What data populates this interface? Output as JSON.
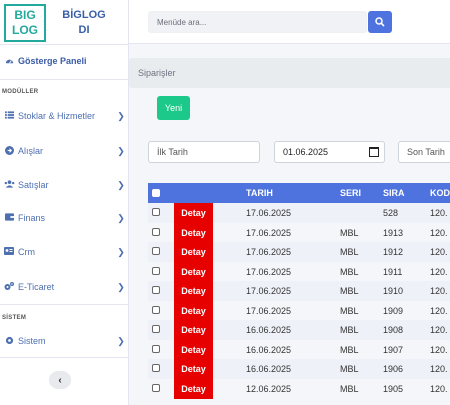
{
  "logo": {
    "line1": "BIG",
    "line2": "LOG"
  },
  "brand": {
    "line1": "BİGLOG",
    "line2": "DI"
  },
  "search": {
    "placeholder": "Menüde ara..."
  },
  "sidebar": {
    "dashboard": "Gösterge Paneli",
    "section_modules": "MODÜLLER",
    "section_system": "SİSTEM",
    "items": [
      {
        "label": "Stoklar & Hizmetler",
        "icon": "list-icon"
      },
      {
        "label": "Alışlar",
        "icon": "arrow-circle-icon"
      },
      {
        "label": "Satışlar",
        "icon": "users-icon"
      },
      {
        "label": "Finans",
        "icon": "wallet-icon"
      },
      {
        "label": "Crm",
        "icon": "id-card-icon"
      },
      {
        "label": "E-Ticaret",
        "icon": "gears-icon"
      },
      {
        "label": "Sistem",
        "icon": "gear-icon"
      }
    ]
  },
  "breadcrumb": "Siparişler",
  "new_button": "Yeni",
  "filters": {
    "start_placeholder": "İlk Tarih",
    "date_value": "01.06.2025",
    "end_placeholder": "Son Tarih"
  },
  "table": {
    "headers": [
      "TARIH",
      "SERI",
      "SIRA",
      "KOD"
    ],
    "detail_label": "Detay",
    "rows": [
      {
        "date": "17.06.2025",
        "seri": "",
        "sira": "528",
        "kod": "120."
      },
      {
        "date": "17.06.2025",
        "seri": "MBL",
        "sira": "1913",
        "kod": "120."
      },
      {
        "date": "17.06.2025",
        "seri": "MBL",
        "sira": "1912",
        "kod": "120."
      },
      {
        "date": "17.06.2025",
        "seri": "MBL",
        "sira": "1911",
        "kod": "120."
      },
      {
        "date": "17.06.2025",
        "seri": "MBL",
        "sira": "1910",
        "kod": "120."
      },
      {
        "date": "17.06.2025",
        "seri": "MBL",
        "sira": "1909",
        "kod": "120."
      },
      {
        "date": "16.06.2025",
        "seri": "MBL",
        "sira": "1908",
        "kod": "120."
      },
      {
        "date": "16.06.2025",
        "seri": "MBL",
        "sira": "1907",
        "kod": "120."
      },
      {
        "date": "16.06.2025",
        "seri": "MBL",
        "sira": "1906",
        "kod": "120."
      },
      {
        "date": "12.06.2025",
        "seri": "MBL",
        "sira": "1905",
        "kod": "120."
      }
    ]
  },
  "colors": {
    "primary": "#4e73df",
    "success": "#1cc88a",
    "danger": "#e60000",
    "brand": "#24a99d"
  }
}
